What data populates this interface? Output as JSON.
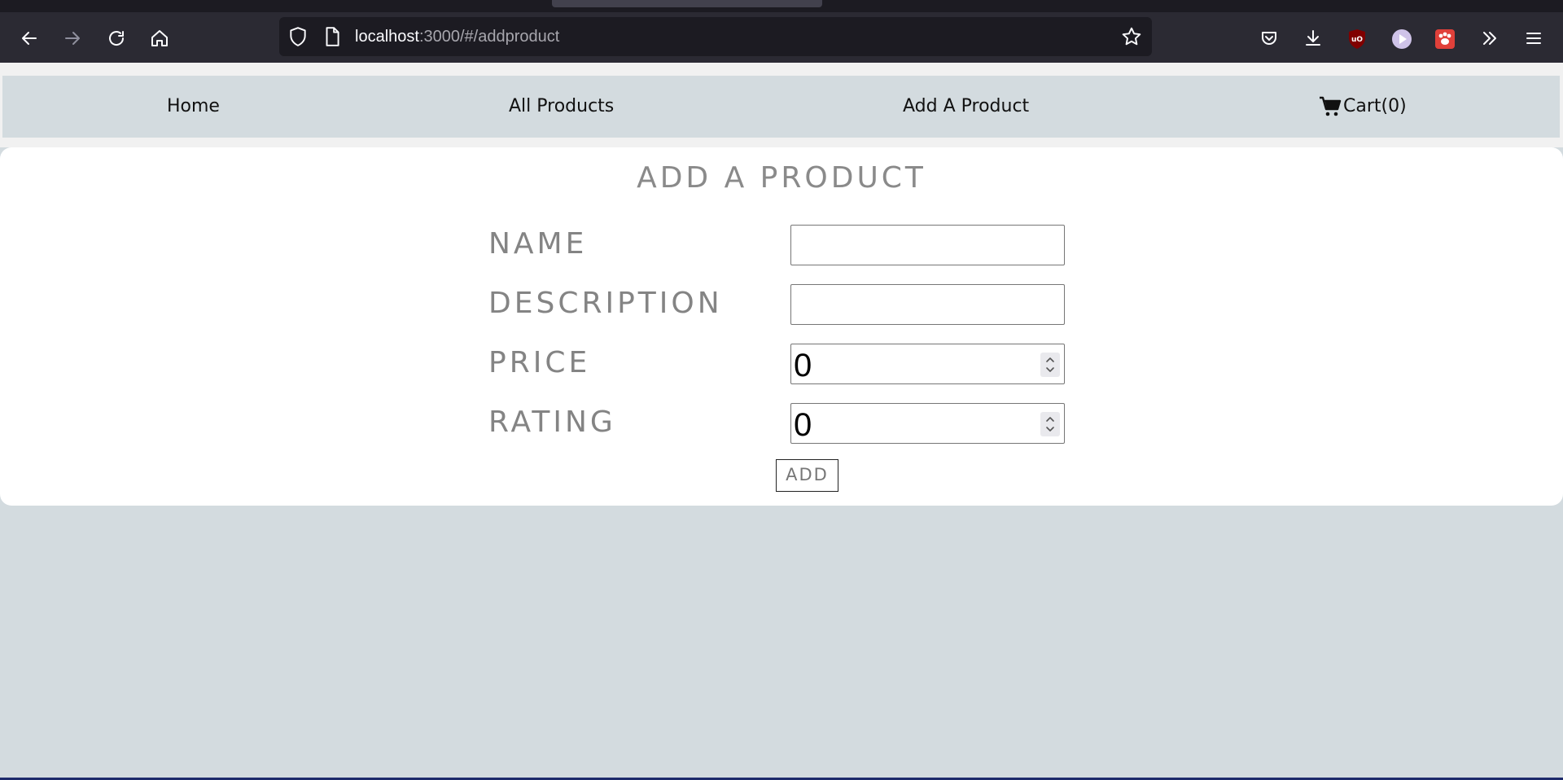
{
  "browser": {
    "url_host": "localhost",
    "url_rest": ":3000/#/addproduct"
  },
  "nav": {
    "home": "Home",
    "all_products": "All Products",
    "add_product": "Add A Product",
    "cart": "Cart(0)"
  },
  "form": {
    "title": "ADD A PRODUCT",
    "labels": {
      "name": "NAME",
      "description": "DESCRIPTION",
      "price": "PRICE",
      "rating": "RATING"
    },
    "values": {
      "name": "",
      "description": "",
      "price": "0",
      "rating": "0"
    },
    "submit_label": "ADD"
  }
}
